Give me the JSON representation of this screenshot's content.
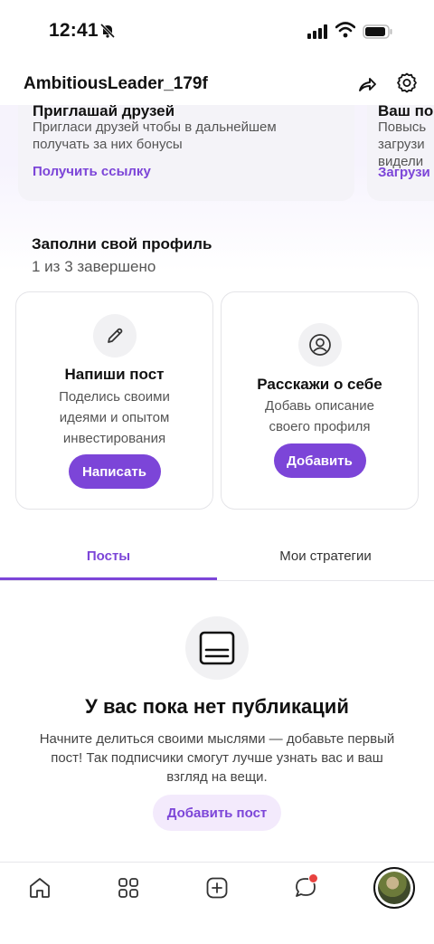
{
  "status_bar": {
    "time": "12:41"
  },
  "header": {
    "username": "AmbitiousLeader_179f"
  },
  "promo_cards": [
    {
      "title": "Приглашай друзей",
      "text_line1": "Пригласи друзей чтобы в дальнейшем",
      "text_line2": "получать за них бонусы",
      "link": "Получить ссылку"
    },
    {
      "title": "Ваш по",
      "text_line1": "Повысь",
      "text_line2": "загрузи",
      "text_line3": "видели",
      "link": "Загрузи"
    }
  ],
  "profile": {
    "title": "Заполни свой профиль",
    "progress": "1 из 3 завершено"
  },
  "tasks": [
    {
      "title": "Напиши пост",
      "desc_line1": "Поделись своими",
      "desc_line2": "идеями и опытом",
      "desc_line3": "инвестирования",
      "button": "Написать",
      "icon": "pencil-icon"
    },
    {
      "title": "Расскажи о себе",
      "desc_line1": "Добавь описание",
      "desc_line2": "своего профиля",
      "button": "Добавить",
      "icon": "user-circle-icon"
    }
  ],
  "tabs": [
    {
      "label": "Посты",
      "active": true
    },
    {
      "label": "Мои стратегии",
      "active": false
    }
  ],
  "empty_state": {
    "title": "У вас пока нет публикаций",
    "desc_line1": "Начните делиться своими мыслями — добавьте первый",
    "desc_line2": "пост! Так подписчики смогут лучше узнать вас и ваш",
    "desc_line3": "взгляд на вещи.",
    "button": "Добавить пост"
  },
  "bottom_nav": [
    "home-icon",
    "grid-icon",
    "add-icon",
    "chat-icon",
    "avatar"
  ],
  "colors": {
    "accent": "#7c45d8",
    "accent_soft": "#f3eafc",
    "notification": "#e8423f"
  }
}
